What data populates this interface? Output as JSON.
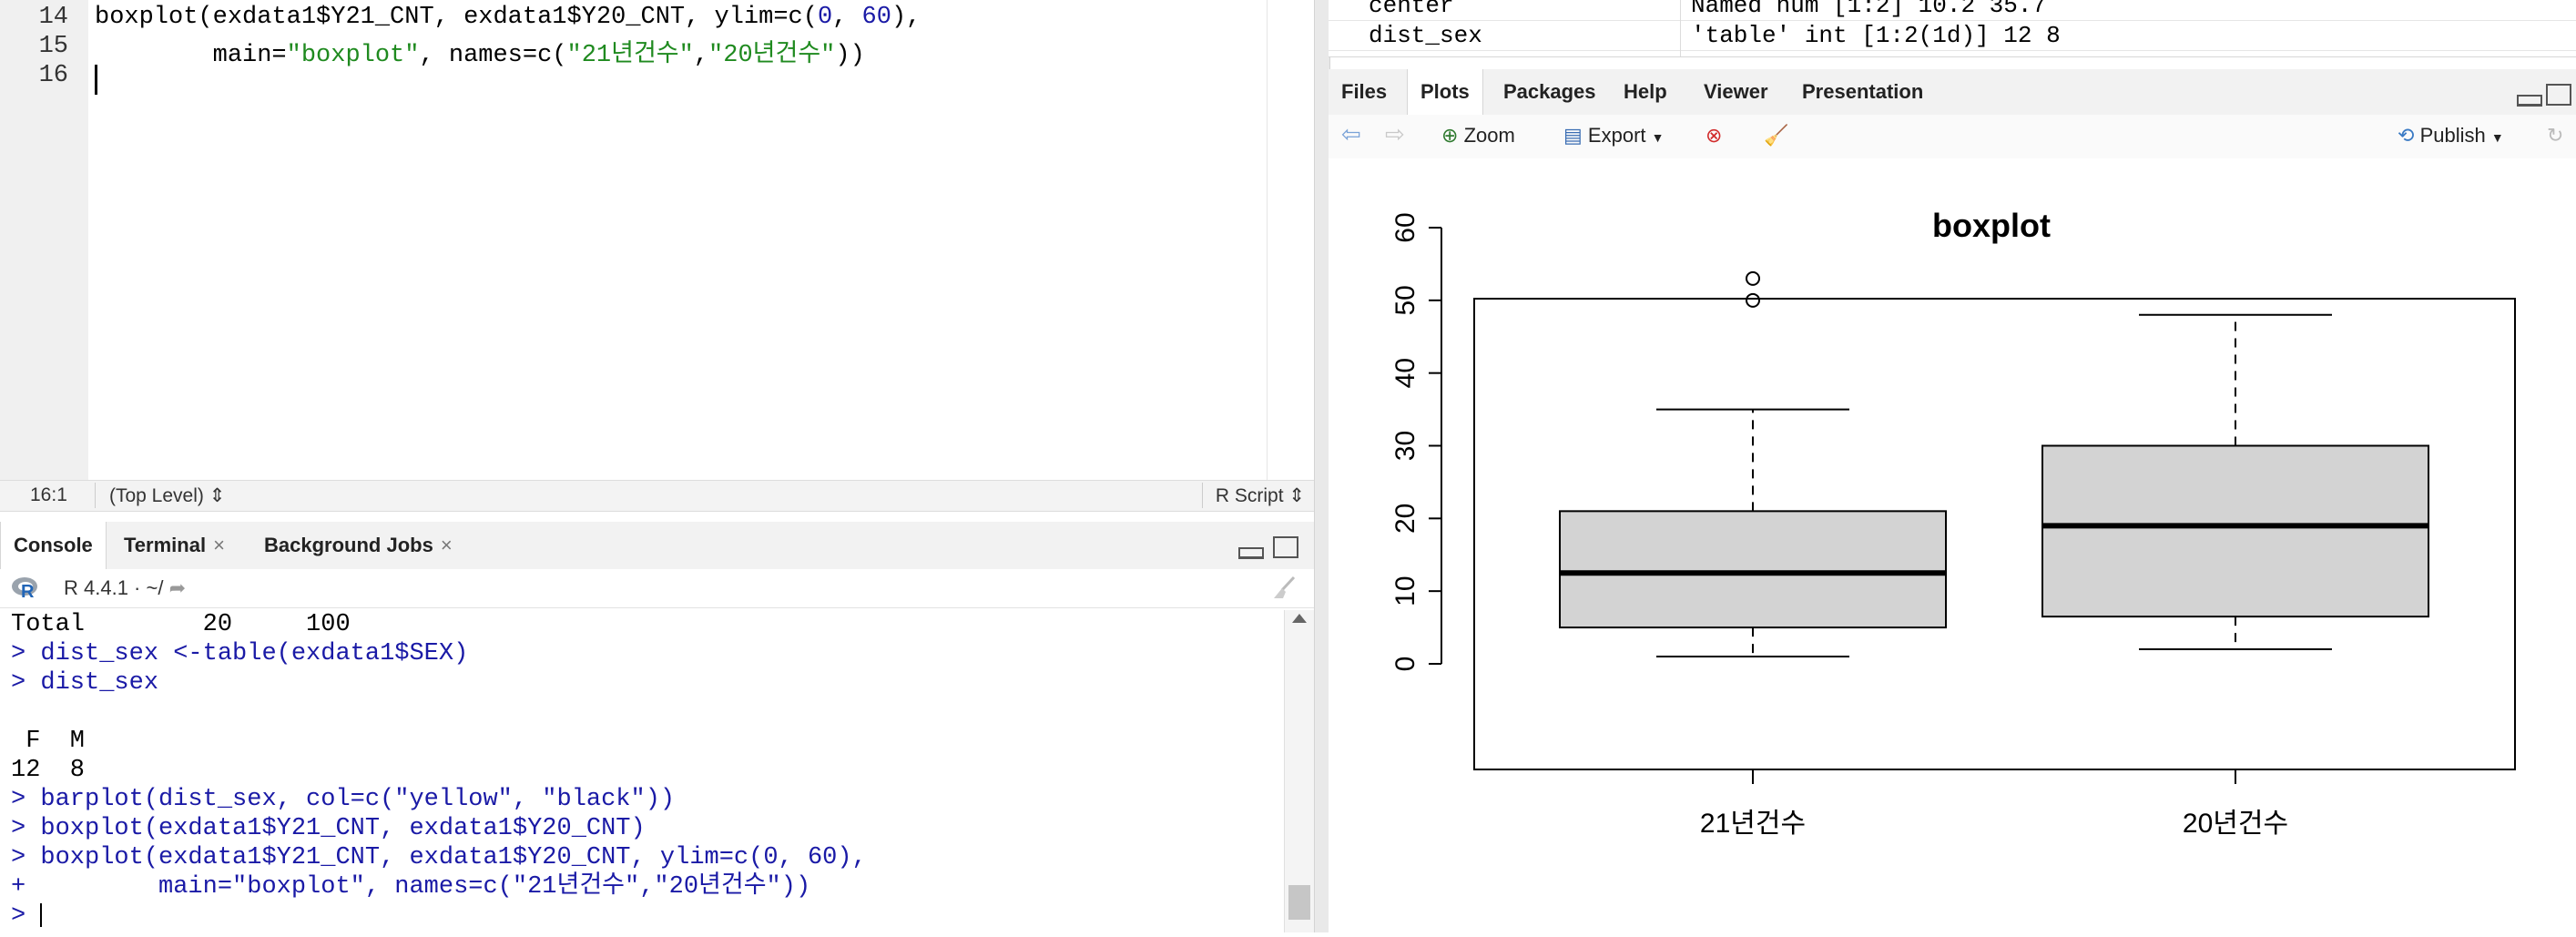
{
  "editor": {
    "line_numbers": [
      "14",
      "15",
      "16"
    ],
    "status": {
      "position": "16:1",
      "scope": "(Top Level)",
      "file_type": "R Script"
    }
  },
  "console": {
    "tabs": [
      {
        "label": "Console"
      },
      {
        "label": "Terminal"
      },
      {
        "label": "Background Jobs"
      }
    ],
    "r_version": "R 4.4.1",
    "path": "~/"
  },
  "environment": {
    "rows": [
      {
        "name": "center",
        "value": "Named num [1:2] 10.2 35.7"
      },
      {
        "name": "dist_sex",
        "value": "'table' int [1:2(1d)] 12 8"
      }
    ]
  },
  "plots_pane": {
    "tabs": [
      "Files",
      "Plots",
      "Packages",
      "Help",
      "Viewer",
      "Presentation"
    ],
    "active_tab": "Plots",
    "toolbar": {
      "zoom": "Zoom",
      "export": "Export",
      "publish": "Publish"
    }
  },
  "chart_data": {
    "type": "boxplot",
    "title": "boxplot",
    "categories": [
      "21년건수",
      "20년건수"
    ],
    "ylim": [
      0,
      60
    ],
    "yticks": [
      0,
      10,
      20,
      30,
      40,
      50,
      60
    ],
    "boxes": [
      {
        "name": "21년건수",
        "whisker_low": 1,
        "q1": 5,
        "median": 12.5,
        "q3": 21,
        "whisker_high": 35,
        "outliers": [
          50,
          53
        ]
      },
      {
        "name": "20년건수",
        "whisker_low": 2,
        "q1": 6.5,
        "median": 19,
        "q3": 30,
        "whisker_high": 48,
        "outliers": []
      }
    ],
    "colors": {
      "box_fill": "#d3d3d3",
      "stroke": "#000000"
    }
  }
}
